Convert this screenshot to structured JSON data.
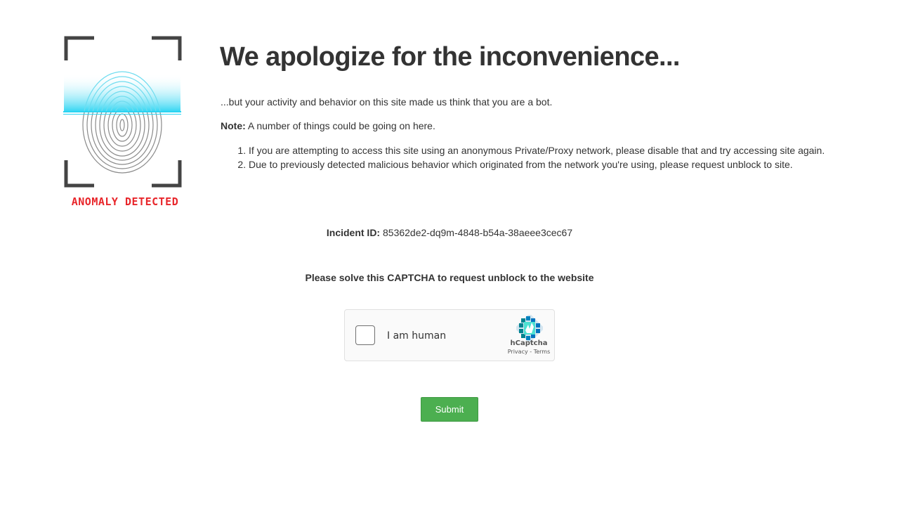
{
  "logo": {
    "icon": "fingerprint-scan-icon",
    "caption": "ANOMALY DETECTED",
    "caption_color": "#e8262b",
    "scan_color": "#2ad4f2"
  },
  "heading": "We apologize for the inconvenience...",
  "intro": "...but your activity and behavior on this site made us think that you are a bot.",
  "note": {
    "label": "Note:",
    "text": " A number of things could be going on here."
  },
  "reasons": [
    "If you are attempting to access this site using an anonymous Private/Proxy network, please disable that and try accessing site again.",
    "Due to previously detected malicious behavior which originated from the network you're using, please request unblock to site."
  ],
  "incident": {
    "label": "Incident ID:",
    "value": " 85362de2-dq9m-4848-b54a-38aeee3cec67"
  },
  "captcha_prompt": "Please solve this CAPTCHA to request unblock to the website",
  "captcha": {
    "checkbox_label": "I am human",
    "brand": "hCaptcha",
    "privacy_link": "Privacy",
    "separator": " - ",
    "terms_link": "Terms",
    "icon": "hcaptcha-logo-icon"
  },
  "submit_label": "Submit",
  "colors": {
    "submit_bg": "#4caf50",
    "text": "#333333"
  }
}
